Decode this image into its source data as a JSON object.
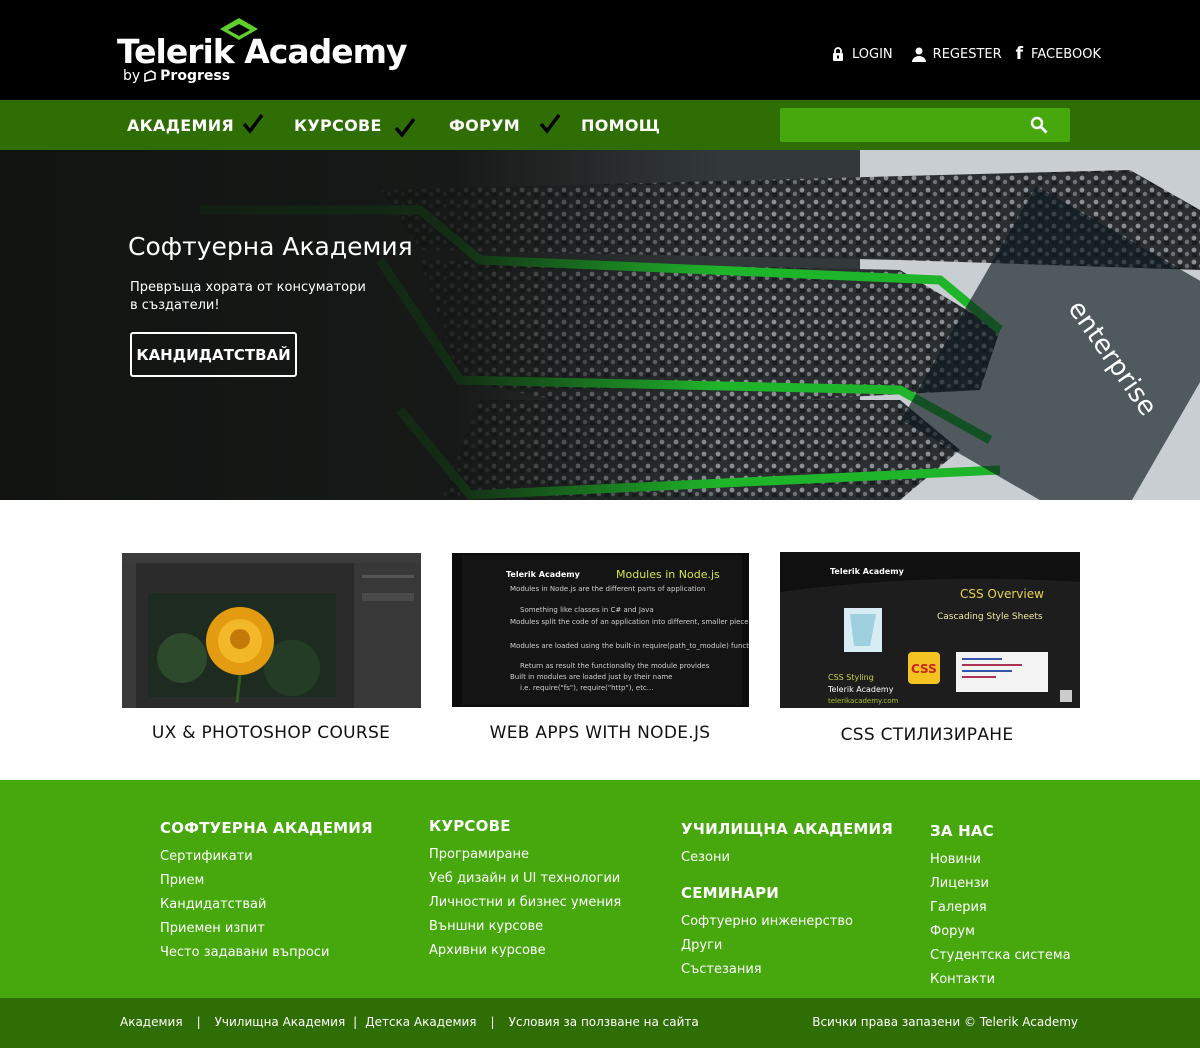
{
  "header": {
    "logo_title": "Telerik Academy",
    "logo_by": "by",
    "logo_brand": "Progress",
    "links": [
      {
        "label": "LOGIN",
        "icon": "lock-icon"
      },
      {
        "label": "REGESTER",
        "icon": "user-icon"
      },
      {
        "label": "FACEBOOK",
        "icon": "facebook-icon"
      }
    ],
    "fb_glyph": "f"
  },
  "nav": {
    "items": [
      "АКАДЕМИЯ",
      "КУРСОВЕ",
      "ФОРУМ",
      "ПОМОЩ"
    ],
    "search": {
      "value": "",
      "placeholder": "",
      "icon": "search-icon"
    }
  },
  "hero": {
    "title": "Софтуерна Академия",
    "subtitle": "Превръща хората от консуматори в създатели!",
    "cta": "КАНДИДАТСТВАЙ",
    "sign_text": "enterprise"
  },
  "courses": [
    {
      "title": "UX & PHOTOSHOP COURSE"
    },
    {
      "title": "WEB APPS WITH NODE.JS",
      "thumb_brand": "Telerik Academy",
      "thumb_heading": "Modules in Node.js",
      "bullets": [
        "Modules in Node.js are the different parts of application",
        "Something like classes in C# and Java",
        "Modules split the code of an application into different, smaller pieces",
        "Modules are loaded using the built-in require(path_to_module) function",
        "Return as result the functionality the module provides",
        "Built in modules are loaded just by their name",
        "i.e. require(\"fs\"), require(\"http\"), etc..."
      ]
    },
    {
      "title": "CSS СТИЛИЗИРАНЕ",
      "thumb_brand": "Telerik Academy",
      "thumb_heading": "CSS Overview",
      "thumb_sub": "Cascading Style Sheets",
      "thumb_badge": "CSS",
      "thumb_footer1": "CSS Styling",
      "thumb_footer2": "Telerik Academy",
      "thumb_footer3": "telerikacademy.com"
    }
  ],
  "footer": {
    "columns": [
      {
        "heading": "СОФТУЕРНА АКАДЕМИЯ",
        "links": [
          "Сертификати",
          "Прием",
          "Кандидатствай",
          "Приемен изпит",
          "Често задавани въпроси"
        ]
      },
      {
        "heading": "КУРСОВЕ",
        "links": [
          "Програмиране",
          "Уеб дизайн и UI технологии",
          "Личностни и бизнес умения",
          "Външни курсове",
          "Архивни курсове"
        ]
      },
      {
        "heading": "УЧИЛИЩНА АКАДЕМИЯ",
        "links": [
          "Сезони"
        ],
        "heading2": "СЕМИНАРИ",
        "links2": [
          "Софтуерно инженерство",
          "Други",
          "Състезания"
        ]
      },
      {
        "heading": "ЗА НАС",
        "links": [
          "Новини",
          "Лицензи",
          "Галерия",
          "Форум",
          "Студентска система",
          "Контакти"
        ]
      }
    ],
    "bottom_links": [
      "Академия",
      "Училищна Академия",
      "Детска Академия",
      "Условия за ползване на сайта"
    ],
    "separator": "|",
    "copyright": "Всички права запазени  ©  Telerik Academy"
  },
  "colors": {
    "header_bg": "#000000",
    "nav_bg": "#2f6e05",
    "search_bg": "#47a80d",
    "footer_bg": "#47a80d",
    "bottom_bg": "#2f6e05",
    "accent": "#6cc83a"
  }
}
